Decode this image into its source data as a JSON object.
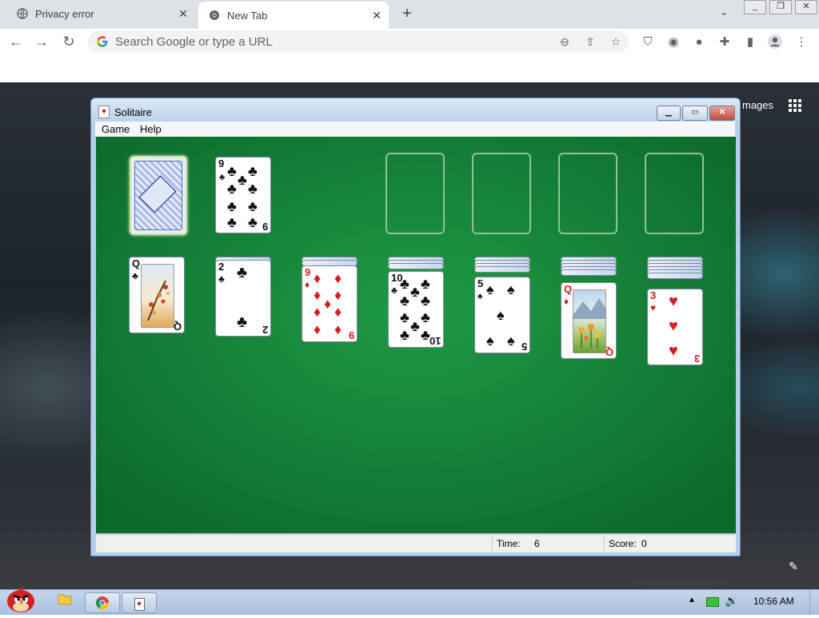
{
  "browser": {
    "tabs": [
      {
        "title": "Privacy error",
        "active": false
      },
      {
        "title": "New Tab",
        "active": true
      }
    ],
    "omnibox_placeholder": "Search Google or type a URL",
    "window_buttons": [
      "_",
      "❐",
      "✕"
    ]
  },
  "ntp": {
    "images_link": "mages"
  },
  "solitaire": {
    "title": "Solitaire",
    "menu": [
      "Game",
      "Help"
    ],
    "status": {
      "time_label": "Time:",
      "time_value": "6",
      "score_label": "Score:",
      "score_value": "0"
    },
    "stock": "card-back",
    "waste": {
      "rank": "9",
      "suit": "♣",
      "color": "black"
    },
    "foundations": [
      null,
      null,
      null,
      null
    ],
    "tableau": [
      {
        "hidden": 0,
        "top": {
          "rank": "Q",
          "suit": "♣",
          "color": "black",
          "face": true
        }
      },
      {
        "hidden": 1,
        "top": {
          "rank": "2",
          "suit": "♣",
          "color": "black",
          "face": false
        }
      },
      {
        "hidden": 2,
        "top": {
          "rank": "9",
          "suit": "♦",
          "color": "red",
          "face": false
        }
      },
      {
        "hidden": 3,
        "top": {
          "rank": "10",
          "suit": "♣",
          "color": "black",
          "face": false
        }
      },
      {
        "hidden": 4,
        "top": {
          "rank": "5",
          "suit": "♠",
          "color": "black",
          "face": false
        }
      },
      {
        "hidden": 5,
        "top": {
          "rank": "Q",
          "suit": "♦",
          "color": "red",
          "face": true
        }
      },
      {
        "hidden": 6,
        "top": {
          "rank": "3",
          "suit": "♥",
          "color": "red",
          "face": false
        }
      }
    ]
  },
  "taskbar": {
    "clock": "10:56 AM"
  },
  "colors": {
    "felt": "#16853a",
    "red_suit": "#d02020",
    "black_suit": "#111111",
    "taskbar": "#b8cbe4"
  }
}
